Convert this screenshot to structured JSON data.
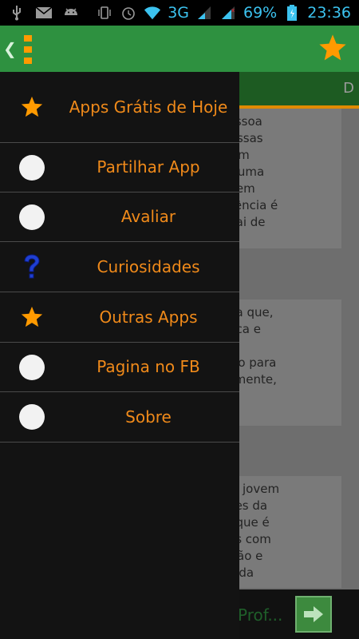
{
  "status_bar": {
    "icons_left": [
      "usb-icon",
      "mail-icon",
      "android-icon"
    ],
    "icons_right": [
      "vibrate-icon",
      "alarm-icon",
      "wifi-icon"
    ],
    "network": "3G",
    "battery_percent": "69%",
    "time": "23:36"
  },
  "action_bar": {
    "background": "#2e9140",
    "accent": "#ff9a00"
  },
  "background_tabs": {
    "visible_letter": "D"
  },
  "background_cards": [
    {
      "text": "uma pessoa\nutora. Essas\ntornar um\nsam de uma\nquase sem\nsa tendência é\ndente pai de"
    },
    {
      "text": "a pessoa que,\nantipática e\ns seus\na a razão para\nm, sutilmente,\nmundo."
    },
    {
      "text": "a a uma jovem\nticipantes da\npessoa que é\ns tarefas com\nbservação e\nis lados da"
    }
  ],
  "ad_bar": {
    "text": "Prof..."
  },
  "drawer": {
    "items": [
      {
        "label": "Apps Grátis de Hoje",
        "icon": "star-icon"
      },
      {
        "label": "Partilhar App",
        "icon": "circle-icon"
      },
      {
        "label": "Avaliar",
        "icon": "circle-icon"
      },
      {
        "label": "Curiosidades",
        "icon": "question-icon"
      },
      {
        "label": "Outras Apps",
        "icon": "star-icon"
      },
      {
        "label": "Pagina no FB",
        "icon": "circle-icon"
      },
      {
        "label": "Sobre",
        "icon": "circle-icon"
      }
    ]
  }
}
